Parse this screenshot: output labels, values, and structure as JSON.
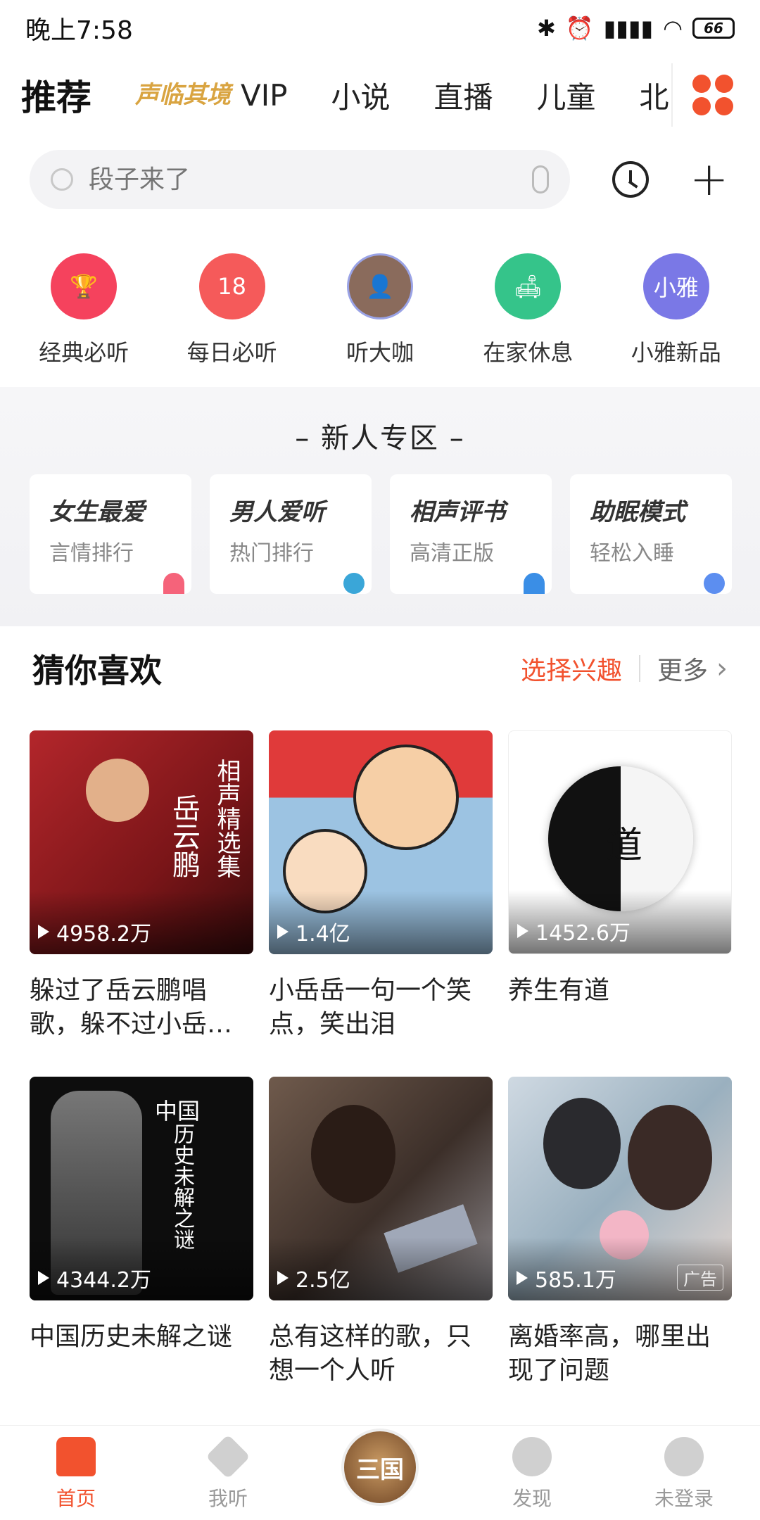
{
  "status_bar": {
    "time": "晚上7:58",
    "battery": "66"
  },
  "tabs": {
    "active": "推荐",
    "special": "声临其境",
    "items": [
      "VIP",
      "小说",
      "直播",
      "儿童",
      "北京"
    ]
  },
  "search": {
    "placeholder": "段子来了"
  },
  "quick_entries": [
    {
      "label": "经典必听",
      "color": "#f5425d",
      "icon": "trophy-icon"
    },
    {
      "label": "每日必听",
      "color": "#f55a5a",
      "icon": "calendar-icon",
      "badge": "18"
    },
    {
      "label": "听大咖",
      "color": "#8a6b5c",
      "icon": "avatar-icon"
    },
    {
      "label": "在家休息",
      "color": "#35c48a",
      "icon": "sofa-icon"
    },
    {
      "label": "小雅新品",
      "color": "#7a78e6",
      "icon": "xiaoya-icon",
      "badge": "小雅"
    }
  ],
  "newbie": {
    "title": "新人专区",
    "cards": [
      {
        "title": "女生最爱",
        "sub": "言情排行",
        "deco": "#f5637a"
      },
      {
        "title": "男人爱听",
        "sub": "热门排行",
        "deco": "#3aa6d8"
      },
      {
        "title": "相声评书",
        "sub": "高清正版",
        "deco": "#3a8ee6"
      },
      {
        "title": "助眠模式",
        "sub": "轻松入睡",
        "deco": "#5c8ef0"
      }
    ]
  },
  "guess": {
    "title": "猜你喜欢",
    "choose": "选择兴趣",
    "more": "更多"
  },
  "albums": [
    {
      "plays": "4958.2万",
      "title": "躲过了岳云鹏唱歌，躲不过小岳…",
      "cover_text": "相声精选集 岳云鹏",
      "bg": "#8e1f22"
    },
    {
      "plays": "1.4亿",
      "title": "小岳岳一句一个笑点，笑出泪",
      "cover_text": "",
      "bg": "#8fb7d8"
    },
    {
      "plays": "1452.6万",
      "title": "养生有道",
      "cover_text": "道",
      "bg": "#ffffff"
    },
    {
      "plays": "4344.2万",
      "title": "中国历史未解之谜",
      "cover_text": "中国 历史未解之谜",
      "bg": "#111111"
    },
    {
      "plays": "2.5亿",
      "title": "总有这样的歌，只想一个人听",
      "cover_text": "",
      "bg": "#4d3c33"
    },
    {
      "plays": "585.1万",
      "title": "离婚率高，哪里出现了问题",
      "cover_text": "",
      "bg": "#9ab0bf",
      "ad": "广告"
    }
  ],
  "bottom_nav": [
    {
      "label": "首页",
      "active": true
    },
    {
      "label": "我听",
      "active": false
    },
    {
      "label": "",
      "center": true
    },
    {
      "label": "发现",
      "active": false
    },
    {
      "label": "未登录",
      "active": false
    }
  ],
  "colors": {
    "accent": "#f2522e"
  }
}
